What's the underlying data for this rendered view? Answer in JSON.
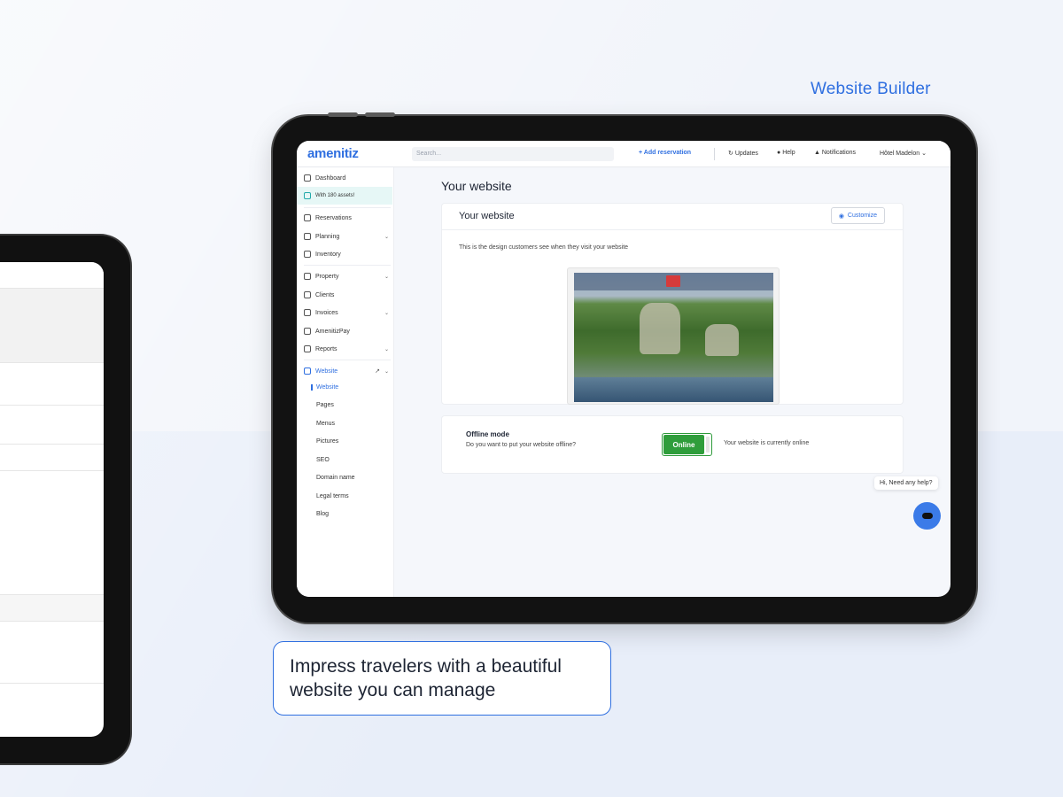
{
  "promo": {
    "label": "Website Builder",
    "caption": "Impress travelers with a beautiful website you can manage"
  },
  "app": {
    "logo": "amenitiz",
    "search_placeholder": "Search...",
    "add_reservation": "+ Add reservation",
    "topbar": {
      "updates": "Updates",
      "help": "Help",
      "notifications": "Notifications",
      "user": "Hôtel Madelon ⌄"
    },
    "sidebar": {
      "items": [
        {
          "label": "Dashboard"
        },
        {
          "label": "With 180 assets!"
        },
        {
          "label": "Reservations"
        },
        {
          "label": "Planning"
        },
        {
          "label": "Inventory"
        },
        {
          "label": "Property"
        },
        {
          "label": "Clients"
        },
        {
          "label": "Invoices"
        },
        {
          "label": "AmenitizPay"
        },
        {
          "label": "Reports"
        },
        {
          "label": "Website"
        }
      ],
      "website_sub": [
        "Website",
        "Pages",
        "Menus",
        "Pictures",
        "SEO",
        "Domain name",
        "Legal terms",
        "Blog"
      ]
    },
    "page_title": "Your website",
    "card": {
      "title": "Your website",
      "customize": "Customize",
      "description": "This is the design customers see when they visit your website"
    },
    "offline": {
      "title": "Offline mode",
      "description": "Do you want to put your website offline?",
      "toggle_label": "Online",
      "status": "Your website is currently online"
    },
    "help_bubble": "Hi, Need any help?"
  },
  "colors": {
    "accent": "#2f6fe0",
    "online_green": "#2f9d3b"
  }
}
